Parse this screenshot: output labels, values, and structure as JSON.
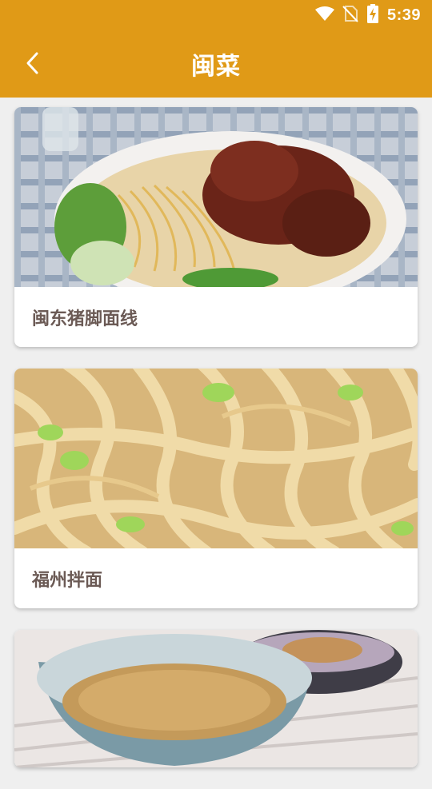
{
  "status_bar": {
    "time": "5:39",
    "icons": [
      "wifi-icon",
      "no-sim-icon",
      "battery-charging-icon"
    ]
  },
  "app_bar": {
    "title": "闽菜",
    "back_icon": "chevron-left-icon"
  },
  "theme": {
    "primary": "#e09a17",
    "background": "#efefef",
    "card_text": "#6b5a55"
  },
  "recipes": [
    {
      "name": "闽东猪脚面线",
      "image": "pork-trotter-noodles-photo"
    },
    {
      "name": "福州拌面",
      "image": "fuzhou-mixed-noodles-photo"
    },
    {
      "name": "",
      "image": "peanut-powder-bowl-photo"
    }
  ]
}
